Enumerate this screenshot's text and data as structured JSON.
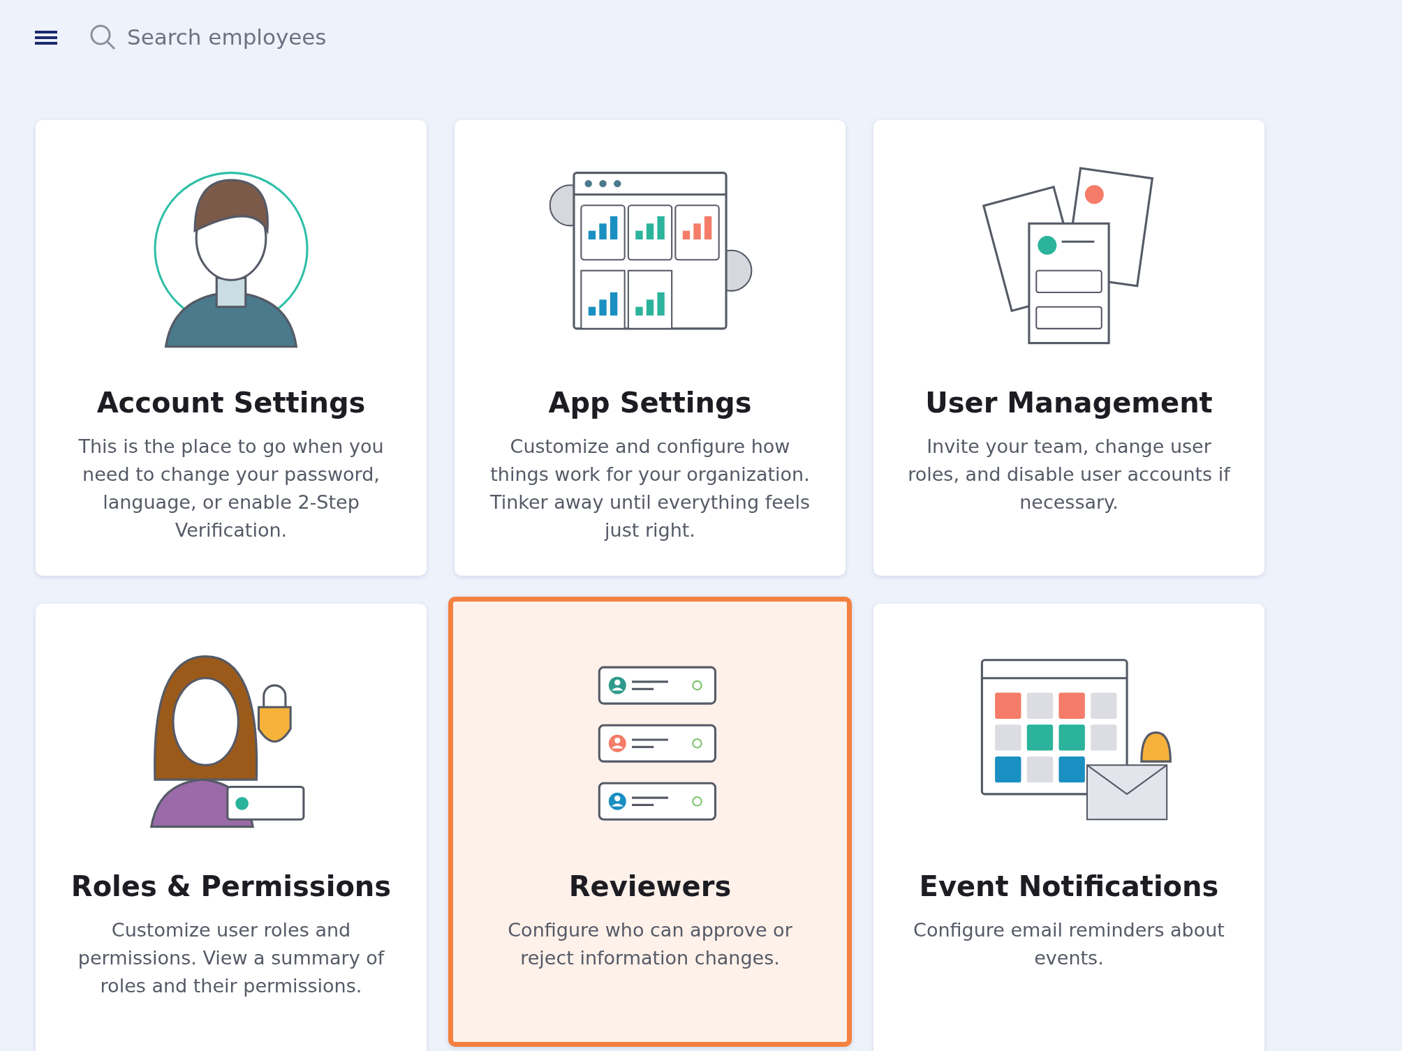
{
  "search": {
    "placeholder": "Search employees"
  },
  "cards": [
    {
      "title": "Account Settings",
      "description": "This is the place to go when you need to change your password, language, or enable 2-Step Verification.",
      "selected": false
    },
    {
      "title": "App Settings",
      "description": "Customize and configure how things work for your organization. Tinker away until everything feels just right.",
      "selected": false
    },
    {
      "title": "User Management",
      "description": "Invite your team, change user roles, and disable user accounts if necessary.",
      "selected": false
    },
    {
      "title": "Roles & Permissions",
      "description": "Customize user roles and permissions. View a summary of roles and their permissions.",
      "selected": false
    },
    {
      "title": "Reviewers",
      "description": "Configure who can approve or reject information changes.",
      "selected": true
    },
    {
      "title": "Event Notifications",
      "description": "Configure email reminders about events.",
      "selected": false
    }
  ]
}
